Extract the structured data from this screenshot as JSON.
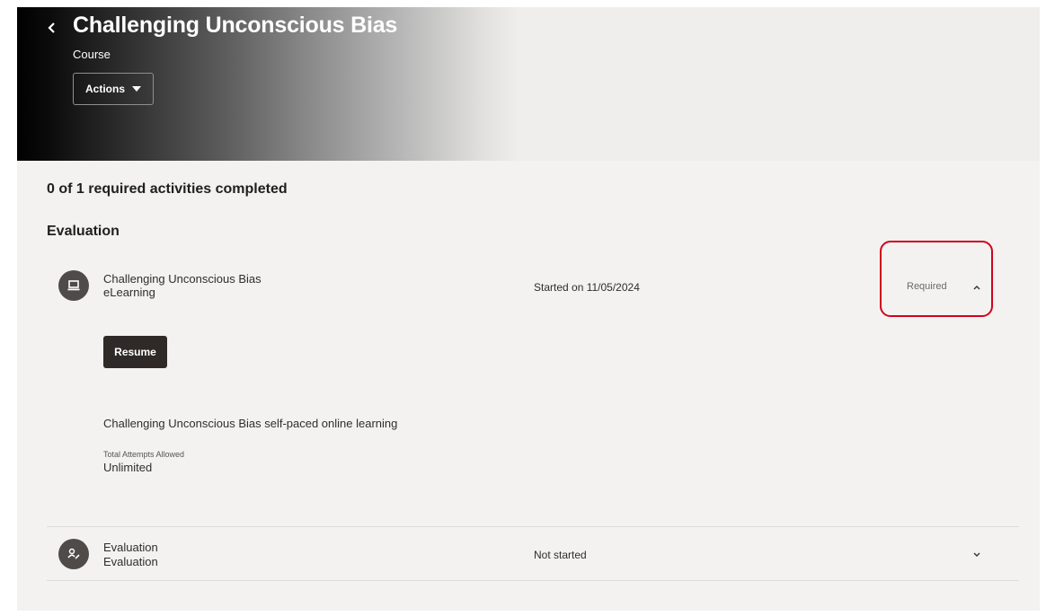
{
  "header": {
    "title": "Challenging Unconscious Bias",
    "subtitle": "Course",
    "actions_label": "Actions"
  },
  "progress_text": "0 of 1 required activities completed",
  "section": {
    "title": "Evaluation",
    "activities": [
      {
        "title": "Challenging Unconscious Bias",
        "type": "eLearning",
        "status": "Started on 11/05/2024",
        "required_label": "Required",
        "expanded": true,
        "icon": "laptop-icon",
        "details": {
          "button_label": "Resume",
          "description": "Challenging Unconscious Bias self-paced online learning",
          "attempts_label": "Total Attempts Allowed",
          "attempts_value": "Unlimited"
        }
      },
      {
        "title": "Evaluation",
        "type": "Evaluation",
        "status": "Not started",
        "expanded": false,
        "icon": "evaluation-icon"
      }
    ]
  },
  "colors": {
    "highlight": "#d0021b",
    "avatar": "#4f4b48",
    "primary_button": "#2f2a27",
    "page_bg": "#f3f2f1"
  }
}
